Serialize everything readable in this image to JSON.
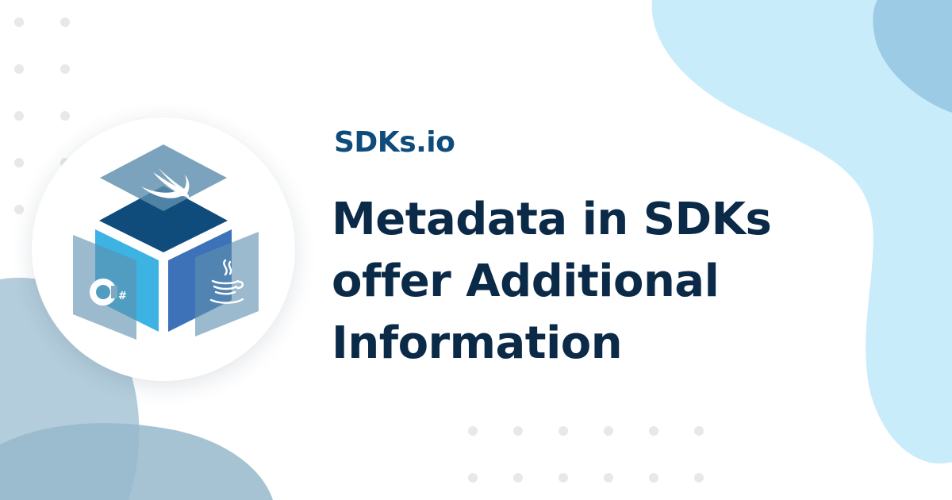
{
  "brand": {
    "name": "SDKs.io"
  },
  "headline": {
    "lines": [
      "Metadata in SDKs",
      "offer Additional",
      "Information"
    ]
  },
  "logo": {
    "language_icons": [
      "swift-icon",
      "csharp-icon",
      "java-icon"
    ],
    "csharp_mark": "#"
  },
  "colors": {
    "brand_text": "#0f4c7c",
    "headline_text": "#0b2a47",
    "blob_light_blue": "#c9ecfa",
    "blob_mid_blue": "#9ccbe6",
    "blob_grey_blue": "#a9c4d4",
    "dot_grey": "#e6e8ea",
    "cube_top": "#0f4c7c",
    "cube_left": "#3cb3e2",
    "cube_right": "#3d72b8",
    "panel_overlay": "#5f8fae"
  }
}
